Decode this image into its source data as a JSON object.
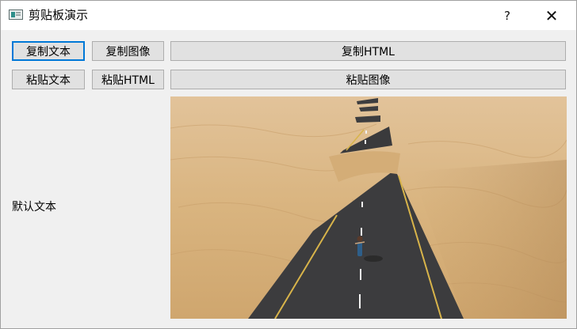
{
  "window": {
    "title": "剪贴板演示",
    "help_label": "?",
    "close_label": "✕"
  },
  "buttons": {
    "copy_text": "复制文本",
    "copy_image": "复制图像",
    "copy_html": "复制HTML",
    "paste_text": "粘贴文本",
    "paste_html": "粘贴HTML",
    "paste_image": "粘贴图像"
  },
  "label": {
    "text": "默认文本"
  },
  "colors": {
    "focus": "#0078d7",
    "button_bg": "#e1e1e1",
    "window_bg": "#f0f0f0"
  },
  "icons": {
    "app": "clipboard-app-icon",
    "close": "close-icon",
    "help": "help-icon"
  }
}
